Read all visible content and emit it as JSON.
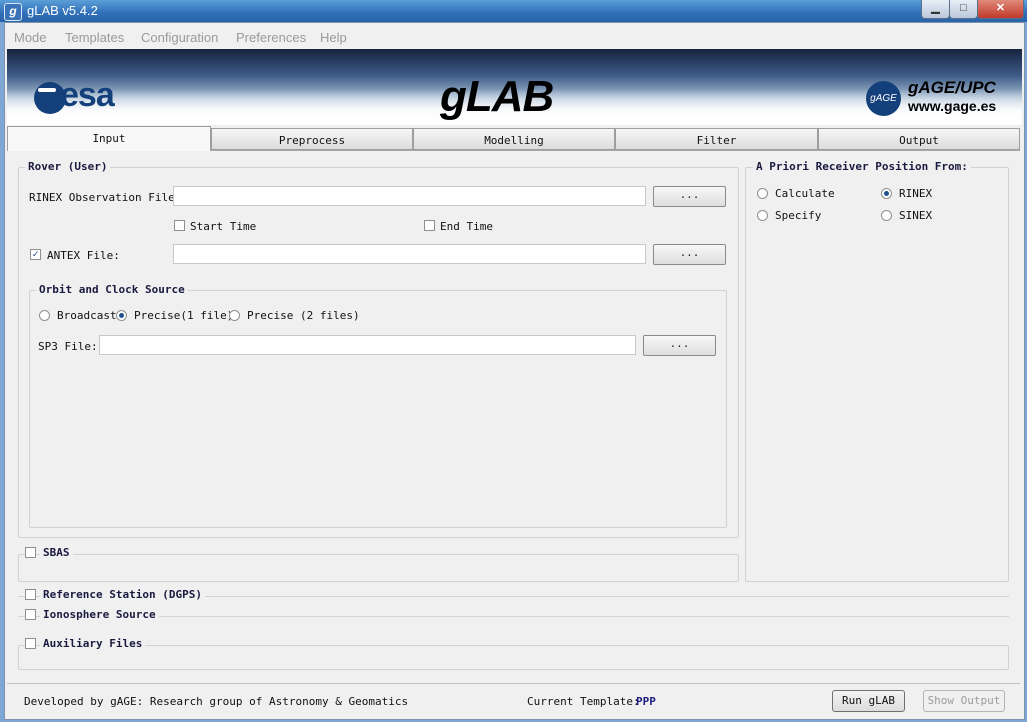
{
  "window": {
    "title": "gLAB v5.4.2",
    "app_icon": "g"
  },
  "menu": [
    "Mode",
    "Templates",
    "Configuration",
    "Preferences",
    "Help"
  ],
  "banner": {
    "esa": "esa",
    "glab": "gLAB",
    "gage_badge": "gAGE",
    "gage_name": "gAGE/UPC",
    "gage_url": "www.gage.es"
  },
  "tabs": [
    "Input",
    "Preprocess",
    "Modelling",
    "Filter",
    "Output"
  ],
  "rover": {
    "title": "Rover (User)",
    "rinex_label": "RINEX Observation File:",
    "rinex_value": "",
    "browse": "...",
    "start_time": "Start Time",
    "end_time": "End Time",
    "antex_label": "ANTEX File:",
    "antex_value": "",
    "antex_checked": "✓",
    "orbit": {
      "title": "Orbit and Clock Source",
      "broadcast": "Broadcast",
      "precise1": "Precise(1 file)",
      "precise2": "Precise (2 files)",
      "sp3_label": "SP3 File:",
      "sp3_value": ""
    }
  },
  "apriori": {
    "title": "A Priori Receiver Position From:",
    "calculate": "Calculate",
    "rinex": "RINEX",
    "specify": "Specify",
    "sinex": "SINEX"
  },
  "sections": {
    "sbas": "SBAS",
    "dgps": "Reference Station (DGPS)",
    "iono": "Ionosphere Source",
    "aux": "Auxiliary Files"
  },
  "footer": {
    "developed": "Developed by gAGE: Research group of Astronomy & Geomatics",
    "template_label": "Current Template:",
    "template_value": "PPP",
    "run": "Run gLAB",
    "show_output": "Show Output"
  },
  "colors": {
    "accent": "#13407a",
    "title_bar": "#2f6fb8",
    "template_value": "#1a1a80"
  }
}
